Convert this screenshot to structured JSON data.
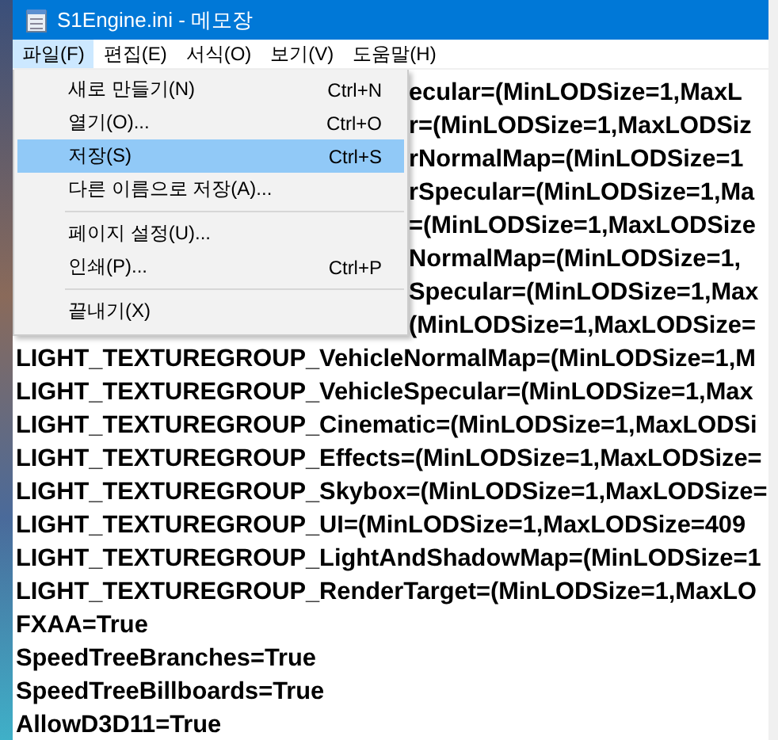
{
  "window": {
    "title": "S1Engine.ini - 메모장"
  },
  "menu_bar": [
    {
      "label": "파일(F)",
      "selected": true
    },
    {
      "label": "편집(E)",
      "selected": false
    },
    {
      "label": "서식(O)",
      "selected": false
    },
    {
      "label": "보기(V)",
      "selected": false
    },
    {
      "label": "도움말(H)",
      "selected": false
    }
  ],
  "file_menu": [
    {
      "kind": "item",
      "label": "새로 만들기(N)",
      "shortcut": "Ctrl+N",
      "selected": false
    },
    {
      "kind": "item",
      "label": "열기(O)...",
      "shortcut": "Ctrl+O",
      "selected": false
    },
    {
      "kind": "item",
      "label": "저장(S)",
      "shortcut": "Ctrl+S",
      "selected": true
    },
    {
      "kind": "item",
      "label": "다른 이름으로 저장(A)...",
      "selected": false
    },
    {
      "kind": "separator"
    },
    {
      "kind": "item",
      "label": "페이지 설정(U)...",
      "selected": false
    },
    {
      "kind": "item",
      "label": "인쇄(P)...",
      "shortcut": "Ctrl+P",
      "selected": false
    },
    {
      "kind": "separator"
    },
    {
      "kind": "item",
      "label": "끝내기(X)",
      "selected": false
    }
  ],
  "editor_lines": [
    {
      "text": "ecular=(MinLODSize=1,MaxL",
      "covered": true
    },
    {
      "text": "r=(MinLODSize=1,MaxLODSiz",
      "covered": true
    },
    {
      "text": "rNormalMap=(MinLODSize=1",
      "covered": true
    },
    {
      "text": "rSpecular=(MinLODSize=1,Ma",
      "covered": true
    },
    {
      "text": "=(MinLODSize=1,MaxLODSize",
      "covered": true
    },
    {
      "text": "NormalMap=(MinLODSize=1,",
      "covered": true
    },
    {
      "text": "Specular=(MinLODSize=1,Max",
      "covered": true
    },
    {
      "text": "(MinLODSize=1,MaxLODSize=",
      "covered": true
    },
    {
      "text": "LIGHT_TEXTUREGROUP_VehicleNormalMap=(MinLODSize=1,M",
      "covered": false
    },
    {
      "text": "LIGHT_TEXTUREGROUP_VehicleSpecular=(MinLODSize=1,Max",
      "covered": false
    },
    {
      "text": "LIGHT_TEXTUREGROUP_Cinematic=(MinLODSize=1,MaxLODSi",
      "covered": false
    },
    {
      "text": "LIGHT_TEXTUREGROUP_Effects=(MinLODSize=1,MaxLODSize=",
      "covered": false
    },
    {
      "text": "LIGHT_TEXTUREGROUP_Skybox=(MinLODSize=1,MaxLODSize=",
      "covered": false
    },
    {
      "text": "LIGHT_TEXTUREGROUP_UI=(MinLODSize=1,MaxLODSize=409",
      "covered": false
    },
    {
      "text": "LIGHT_TEXTUREGROUP_LightAndShadowMap=(MinLODSize=1",
      "covered": false
    },
    {
      "text": "LIGHT_TEXTUREGROUP_RenderTarget=(MinLODSize=1,MaxLO",
      "covered": false
    },
    {
      "text": "FXAA=True",
      "covered": false
    },
    {
      "text": "SpeedTreeBranches=True",
      "covered": false
    },
    {
      "text": "SpeedTreeBillboards=True",
      "covered": false
    },
    {
      "text": "AllowD3D11=True",
      "covered": false
    }
  ]
}
